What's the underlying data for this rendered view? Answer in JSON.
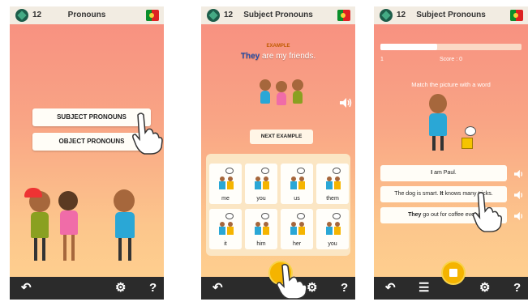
{
  "screens": [
    {
      "title": "Pronouns",
      "coins": "12",
      "buttons": [
        "SUBJECT PRONOUNS",
        "OBJECT PRONOUNS"
      ]
    },
    {
      "title": "Subject Pronouns",
      "coins": "12",
      "example_tag": "EXAMPLE",
      "sentence_bold": "They",
      "sentence_rest": " are my friends.",
      "next_button": "NEXT EXAMPLE",
      "pronouns": [
        "me",
        "you",
        "us",
        "them",
        "it",
        "him",
        "her",
        "you"
      ]
    },
    {
      "title": "Subject Pronouns",
      "coins": "12",
      "progress_left": "1",
      "progress_fraction": 0.4,
      "score": "Score : 0",
      "instruction": "Match the picture with a word",
      "options": [
        {
          "pre": "",
          "bold": "I",
          "post": " am Paul."
        },
        {
          "pre": "The dog is smart. ",
          "bold": "It",
          "post": " knows many tricks."
        },
        {
          "pre": "",
          "bold": "They",
          "post": " go out for coffee every"
        }
      ]
    }
  ],
  "icons": {
    "back": "back-arrow-icon",
    "settings": "gear-icon",
    "help": "question-icon",
    "list": "list-icon",
    "stop": "stop-icon",
    "speaker": "speaker-icon",
    "gem": "gem-icon",
    "flag": "portugal-flag-icon",
    "hand": "pointing-hand-icon"
  },
  "colors": {
    "topbar": "#f2ece2",
    "bottombar": "#2b2b2b",
    "accent": "#f5b400",
    "gradient_top": "#f78e80",
    "gradient_bottom": "#ffd28f"
  }
}
